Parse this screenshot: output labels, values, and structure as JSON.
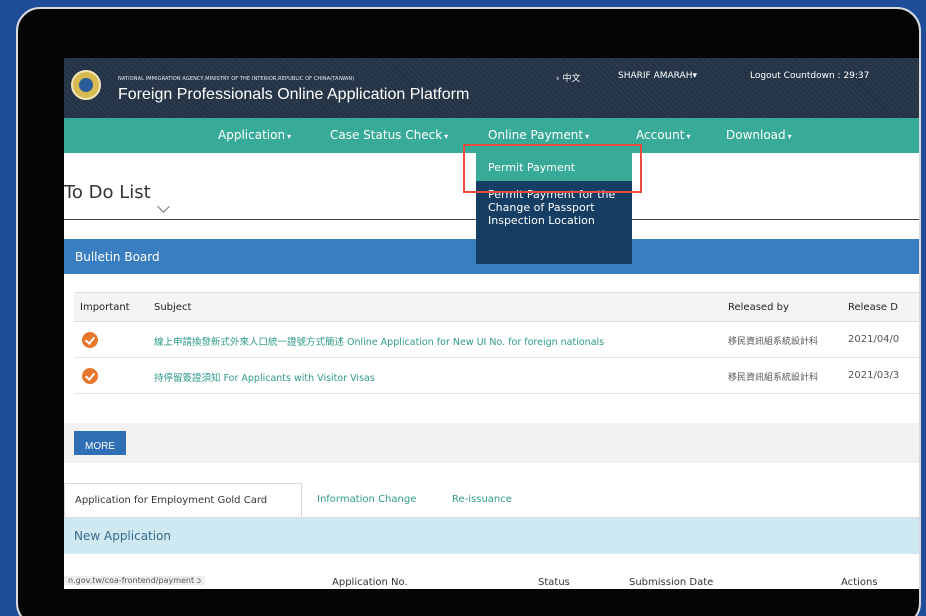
{
  "header": {
    "agency_line": "NATIONAL IMMIGRATION AGENCY,MINISTRY OF THE INTERIOR,REPUBLIC OF CHINA(TAIWAN)",
    "platform_title": "Foreign Professionals Online Application Platform",
    "language_switch": "› 中文",
    "user_name": "SHARIF AMARAH",
    "logout_countdown": "Logout Countdown : 29:37"
  },
  "nav": {
    "items": [
      {
        "label": "Application"
      },
      {
        "label": "Case Status Check"
      },
      {
        "label": "Online Payment"
      },
      {
        "label": "Account"
      },
      {
        "label": "Download"
      }
    ],
    "dropdown": {
      "items": [
        {
          "label": "Permit Payment"
        },
        {
          "label": "Permit Payment for the Change of Passport Inspection Location"
        }
      ]
    }
  },
  "todo": {
    "title": "To Do List"
  },
  "bulletin": {
    "title": "Bulletin Board",
    "columns": [
      "Important",
      "Subject",
      "Released by",
      "Release D"
    ],
    "rows": [
      {
        "subject": "線上申請換發新式外來人口統一證號方式簡述 Online Application for New UI No. for foreign nationals",
        "released_by": "移民資訊組系統設計科",
        "date": "2021/04/0"
      },
      {
        "subject": "持停留簽證須知 For Applicants with Visitor Visas",
        "released_by": "移民資訊組系統設計科",
        "date": "2021/03/3"
      }
    ],
    "more_label": "MORE"
  },
  "tabs": [
    {
      "label": "Application for Employment Gold Card"
    },
    {
      "label": "Information Change"
    },
    {
      "label": "Re-issuance"
    }
  ],
  "new_application": {
    "title": "New Application",
    "status_url": "n.gov.tw/coa-frontend/payment ↄ",
    "columns": [
      "Application No.",
      "Status",
      "Submission Date",
      "Actions"
    ]
  },
  "colors": {
    "nav_green": "#38ab98",
    "bulletin_blue": "#3a7ec2",
    "highlight_red": "#e74c3c",
    "dropdown_navy": "#163d64"
  }
}
